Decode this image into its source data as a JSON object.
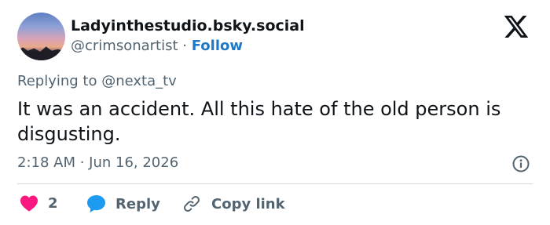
{
  "author": {
    "display_name": "Ladyinthestudio.bsky.social",
    "handle": "@crimsonartist",
    "separator": " · ",
    "follow_label": "Follow"
  },
  "tweet": {
    "replying_to": "Replying to @nexta_tv",
    "text": "It was an accident. All this hate of the old person is disgusting.",
    "timestamp": "2:18 AM · Jun 16, 2026"
  },
  "actions": {
    "like_count": "2",
    "reply_label": "Reply",
    "copy_link_label": "Copy link"
  },
  "icons": {
    "brand": "x-logo-icon",
    "info": "info-icon",
    "like": "heart-icon",
    "reply": "speech-bubble-icon",
    "copy": "link-icon"
  },
  "colors": {
    "heart": "#f91880",
    "reply_bubble": "#1d9bf0",
    "follow": "#1d79c7",
    "secondary_text": "#536471"
  }
}
